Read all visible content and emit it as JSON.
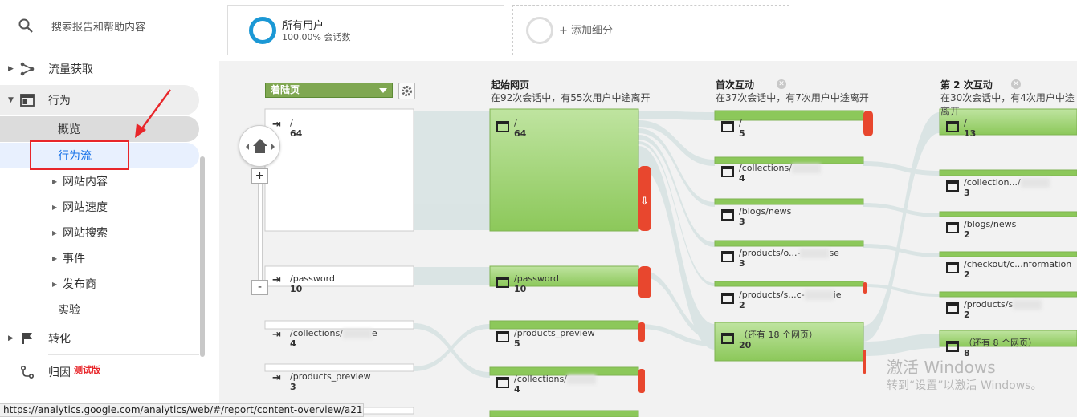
{
  "sidebar": {
    "search_placeholder": "搜索报告和帮助内容",
    "items": [
      {
        "label": "流量获取"
      },
      {
        "label": "行为"
      },
      {
        "label": "转化"
      },
      {
        "label": "归因",
        "badge": "测试版"
      }
    ],
    "behavior_sub": [
      {
        "label": "概览"
      },
      {
        "label": "行为流"
      },
      {
        "label": "网站内容"
      },
      {
        "label": "网站速度"
      },
      {
        "label": "网站搜索"
      },
      {
        "label": "事件"
      },
      {
        "label": "发布商"
      },
      {
        "label": "实验"
      }
    ]
  },
  "segments": {
    "all_users_title": "所有用户",
    "all_users_sub": "100.00% 会话数",
    "add_segment": "+ 添加细分"
  },
  "flow": {
    "dropdown_label": "着陆页",
    "col_start_title": "起始网页",
    "col_start_sub": "在92次会话中，有55次用户中途离开",
    "col_first_title": "首次互动",
    "col_first_sub": "在37次会话中，有7次用户中途离开",
    "col_second_title": "第 2 次互动",
    "col_second_sub": "在30次会话中，有4次用户中途离开",
    "landing": [
      {
        "page": "/",
        "count": "64"
      },
      {
        "page": "/password",
        "count": "10"
      },
      {
        "page": "/collections/",
        "suffix": "e",
        "count": "4"
      },
      {
        "page": "/products_preview",
        "count": "3"
      }
    ],
    "start": [
      {
        "page": "/",
        "count": "64"
      },
      {
        "page": "/password",
        "count": "10"
      },
      {
        "page": "/products_preview",
        "count": "5"
      },
      {
        "page": "/collections/",
        "count": "4"
      }
    ],
    "first": [
      {
        "page": "/",
        "count": "5"
      },
      {
        "page": "/collections/",
        "count": "4"
      },
      {
        "page": "/blogs/news",
        "count": "3"
      },
      {
        "page": "/products/o...-",
        "suffix": "se",
        "count": "3"
      },
      {
        "page": "/products/s...c-",
        "suffix": "ie",
        "count": "2"
      },
      {
        "page": "（还有 18 个网页）",
        "count": "20"
      }
    ],
    "second": [
      {
        "page": "/",
        "count": "13"
      },
      {
        "page": "/collection.../",
        "count": "3"
      },
      {
        "page": "/blogs/news",
        "count": "2"
      },
      {
        "page": "/checkout/c...nformation",
        "count": "2"
      },
      {
        "page": "/products/s",
        "count": "2"
      },
      {
        "page": "（还有 8 个网页）",
        "count": "8"
      }
    ]
  },
  "watermark": {
    "line1": "激活 Windows",
    "line2": "转到“设置”以激活 Windows。"
  },
  "statusbar": {
    "url": "https://analytics.google.com/analytics/web/#/report/content-overview/a21..."
  },
  "colors": {
    "accent": "#1a73e8",
    "node_green": "#8cc85a",
    "dropoff_red": "#e8472e",
    "segment_blue": "#1b98d5"
  }
}
